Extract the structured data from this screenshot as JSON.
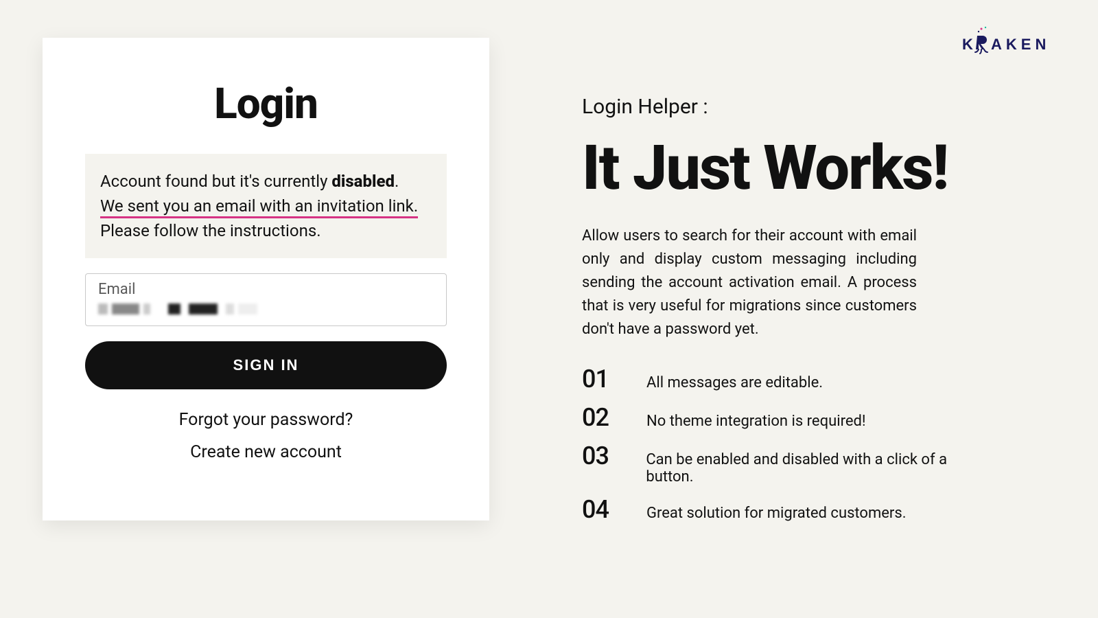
{
  "brand": {
    "name": "KRAKEN",
    "color_text": "#1a1a5e",
    "color_accent": "#d63384"
  },
  "login_card": {
    "title": "Login",
    "notice": {
      "line1_pre": "Account found but it's currently ",
      "line1_bold": "disabled",
      "line1_post": ".",
      "line2": "We sent you an email with an invitation link.",
      "line3": "Please follow the instructions."
    },
    "email_field": {
      "label": "Email",
      "value_redacted": true
    },
    "signin_label": "SIGN IN",
    "forgot_label": "Forgot your password?",
    "create_label": "Create new account"
  },
  "right": {
    "subtitle": "Login Helper :",
    "headline": "It Just Works!",
    "description": "Allow users to search for their account with email only and display custom messaging including sending the account activation email. A process that is very useful for migrations since customers don't have a password yet.",
    "features": [
      {
        "num": "01",
        "text": "All messages are editable."
      },
      {
        "num": "02",
        "text": "No theme integration is required!"
      },
      {
        "num": "03",
        "text": "Can be enabled and disabled with a click of a button."
      },
      {
        "num": "04",
        "text": "Great solution for migrated customers."
      }
    ]
  }
}
